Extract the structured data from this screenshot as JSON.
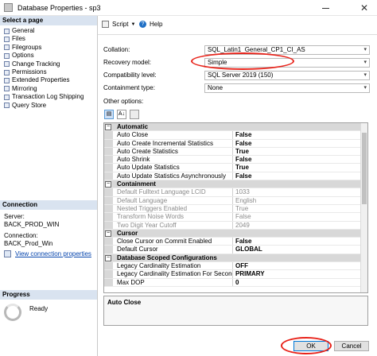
{
  "window": {
    "title": "Database Properties - sp3",
    "close_glyph": "✕"
  },
  "sidebar": {
    "select_page_header": "Select a page",
    "pages": [
      "General",
      "Files",
      "Filegroups",
      "Options",
      "Change Tracking",
      "Permissions",
      "Extended Properties",
      "Mirroring",
      "Transaction Log Shipping",
      "Query Store"
    ],
    "connection": {
      "header": "Connection",
      "server_label": "Server:",
      "server_value": "BACK_PROD_WIN",
      "connection_label": "Connection:",
      "connection_value": "BACK_Prod_Win",
      "view_link": "View connection properties"
    },
    "progress": {
      "header": "Progress",
      "status": "Ready"
    }
  },
  "toolbar": {
    "script_label": "Script",
    "script_caret": "▼",
    "help_label": "Help",
    "help_glyph": "?"
  },
  "props": {
    "collation_label": "Collation:",
    "collation_value": "SQL_Latin1_General_CP1_CI_AS",
    "recovery_label": "Recovery model:",
    "recovery_value": "Simple",
    "compat_label": "Compatibility level:",
    "compat_value": "SQL Server 2019 (150)",
    "containment_label": "Containment type:",
    "containment_value": "None",
    "other_options_label": "Other options:",
    "combo_arrow": "▾"
  },
  "grid": {
    "toggle_glyph": "−",
    "sort_icon_text": "A↓",
    "rows": [
      {
        "kind": "cat",
        "name": "Automatic",
        "value": ""
      },
      {
        "kind": "bold",
        "name": "Auto Close",
        "value": "False"
      },
      {
        "kind": "bold",
        "name": "Auto Create Incremental Statistics",
        "value": "False"
      },
      {
        "kind": "bold",
        "name": "Auto Create Statistics",
        "value": "True"
      },
      {
        "kind": "bold",
        "name": "Auto Shrink",
        "value": "False"
      },
      {
        "kind": "bold",
        "name": "Auto Update Statistics",
        "value": "True"
      },
      {
        "kind": "bold",
        "name": "Auto Update Statistics Asynchronously",
        "value": "False"
      },
      {
        "kind": "cat",
        "name": "Containment",
        "value": ""
      },
      {
        "kind": "dim",
        "name": "Default Fulltext Language LCID",
        "value": "1033"
      },
      {
        "kind": "dim",
        "name": "Default Language",
        "value": "English"
      },
      {
        "kind": "dim",
        "name": "Nested Triggers Enabled",
        "value": "True"
      },
      {
        "kind": "dim",
        "name": "Transform Noise Words",
        "value": "False"
      },
      {
        "kind": "dim",
        "name": "Two Digit Year Cutoff",
        "value": "2049"
      },
      {
        "kind": "cat",
        "name": "Cursor",
        "value": ""
      },
      {
        "kind": "bold",
        "name": "Close Cursor on Commit Enabled",
        "value": "False"
      },
      {
        "kind": "bold",
        "name": "Default Cursor",
        "value": "GLOBAL"
      },
      {
        "kind": "cat",
        "name": "Database Scoped Configurations",
        "value": ""
      },
      {
        "kind": "bold",
        "name": "Legacy Cardinality Estimation",
        "value": "OFF"
      },
      {
        "kind": "bold",
        "name": "Legacy Cardinality Estimation For Secondary",
        "value": "PRIMARY"
      },
      {
        "kind": "bold",
        "name": "Max DOP",
        "value": "0"
      }
    ]
  },
  "description": {
    "title": "Auto Close"
  },
  "footer": {
    "ok_label": "OK",
    "cancel_label": "Cancel"
  },
  "colors": {
    "annotation_red": "#e8231a",
    "section_header_bg": "#d9e3f0"
  }
}
